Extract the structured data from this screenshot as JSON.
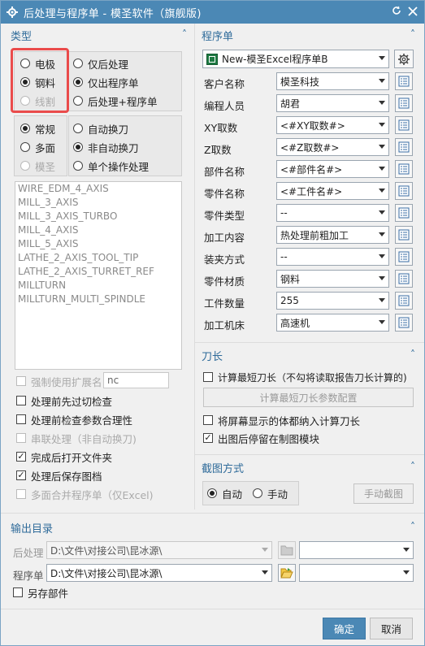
{
  "window": {
    "title": "后处理与程序单 - 模圣软件（旗舰版)"
  },
  "left": {
    "section_title": "类型",
    "group1": [
      {
        "label": "电极",
        "checked": false
      },
      {
        "label": "钢料",
        "checked": true
      },
      {
        "label": "线割",
        "checked": false,
        "disabled": true
      }
    ],
    "group2": [
      {
        "label": "仅后处理",
        "checked": false
      },
      {
        "label": "仅出程序单",
        "checked": true
      },
      {
        "label": "后处理+程序单",
        "checked": false
      }
    ],
    "group3": [
      {
        "label": "常规",
        "checked": true
      },
      {
        "label": "多面",
        "checked": false
      },
      {
        "label": "模圣",
        "checked": false,
        "disabled": true
      }
    ],
    "group4": [
      {
        "label": "自动换刀",
        "checked": false
      },
      {
        "label": "非自动换刀",
        "checked": true
      },
      {
        "label": "单个操作处理",
        "checked": false
      }
    ],
    "postprocessors": [
      "WIRE_EDM_4_AXIS",
      "MILL_3_AXIS",
      "MILL_3_AXIS_TURBO",
      "MILL_4_AXIS",
      "MILL_5_AXIS",
      "LATHE_2_AXIS_TOOL_TIP",
      "LATHE_2_AXIS_TURRET_REF",
      "MILLTURN",
      "MILLTURN_MULTI_SPINDLE"
    ],
    "force_ext_label": "强制使用扩展名",
    "force_ext_value": "nc",
    "options": [
      {
        "label": "处理前先过切检查",
        "checked": false,
        "disabled": false
      },
      {
        "label": "处理前检查参数合理性",
        "checked": false,
        "disabled": false
      },
      {
        "label": "串联处理（非自动换刀)",
        "checked": false,
        "disabled": true
      },
      {
        "label": "完成后打开文件夹",
        "checked": true,
        "disabled": false
      },
      {
        "label": "处理后保存图档",
        "checked": true,
        "disabled": false
      },
      {
        "label": "多面合并程序单（仅Excel)",
        "checked": false,
        "disabled": true
      }
    ]
  },
  "program": {
    "section_title": "程序单",
    "template": "New-模圣Excel程序单B",
    "fields": [
      {
        "label": "客户名称",
        "value": "模圣科技",
        "has_button": true
      },
      {
        "label": "编程人员",
        "value": "胡君",
        "has_button": true
      },
      {
        "label": "XY取数",
        "value": "<#XY取数#>",
        "has_button": true
      },
      {
        "label": "Z取数",
        "value": "<#Z取数#>",
        "has_button": true
      },
      {
        "label": "部件名称",
        "value": "<#部件名#>",
        "has_button": true
      },
      {
        "label": "零件名称",
        "value": "<#工件名#>",
        "has_button": true
      },
      {
        "label": "零件类型",
        "value": "--",
        "has_button": true
      },
      {
        "label": "加工内容",
        "value": "热处理前粗加工",
        "has_button": true
      },
      {
        "label": "装夹方式",
        "value": "--",
        "has_button": true
      },
      {
        "label": "零件材质",
        "value": "钢料",
        "has_button": true
      },
      {
        "label": "工件数量",
        "value": "255",
        "has_button": true
      },
      {
        "label": "加工机床",
        "value": "高速机",
        "has_button": true
      }
    ]
  },
  "tool": {
    "section_title": "刀长",
    "calc_shortest": "计算最短刀长（不勾将读取报告刀长计算的)",
    "calc_config_btn": "计算最短刀长参数配置",
    "include_bodies": "将屏幕显示的体都纳入计算刀长",
    "stay_drafting": "出图后停留在制图模块"
  },
  "capture": {
    "section_title": "截图方式",
    "auto": "自动",
    "manual": "手动",
    "manual_btn": "手动截图"
  },
  "output": {
    "section_title": "输出目录",
    "post_label": "后处理",
    "post_path": "D:\\文件\\对接公司\\昆冰源\\",
    "prog_label": "程序单",
    "prog_path": "D:\\文件\\对接公司\\昆冰源\\",
    "save_part": "另存部件"
  },
  "footer": {
    "ok": "确定",
    "cancel": "取消"
  },
  "colors": {
    "title_bar": "#4b88b5",
    "section_title": "#2f6b9a",
    "highlight": "#ea4b4b"
  }
}
